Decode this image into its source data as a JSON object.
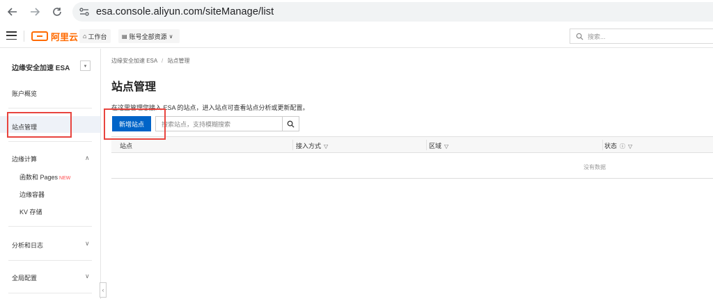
{
  "browser": {
    "url": "esa.console.aliyun.com/siteManage/list"
  },
  "topbar": {
    "logo_text": "阿里云",
    "workbench_label": "工作台",
    "resource_label": "账号全部资源",
    "search_placeholder": "搜索..."
  },
  "sidebar": {
    "product": "边缘安全加速 ESA",
    "toggle": "▾",
    "items": [
      {
        "label": "账户概览"
      },
      {
        "label": "站点管理"
      },
      {
        "label": "边缘计算"
      },
      {
        "label": "函数和 Pages",
        "badge": "NEW"
      },
      {
        "label": "边缘容器"
      },
      {
        "label": "KV 存储"
      },
      {
        "label": "分析和日志"
      },
      {
        "label": "全局配置"
      }
    ]
  },
  "main": {
    "breadcrumb": [
      "边缘安全加速 ESA",
      "/",
      "站点管理"
    ],
    "title": "站点管理",
    "description": "在这里管理您接入 ESA 的站点，进入站点可查看站点分析或更新配置。",
    "new_site_button": "新增站点",
    "search_placeholder": "搜索站点，支持模糊搜索",
    "columns": [
      "站点",
      "接入方式",
      "区域",
      "状态"
    ],
    "empty_text": "没有数据"
  },
  "colors": {
    "accent": "#0064c8",
    "brand": "#ff6a00",
    "highlight": "#e8443e"
  }
}
